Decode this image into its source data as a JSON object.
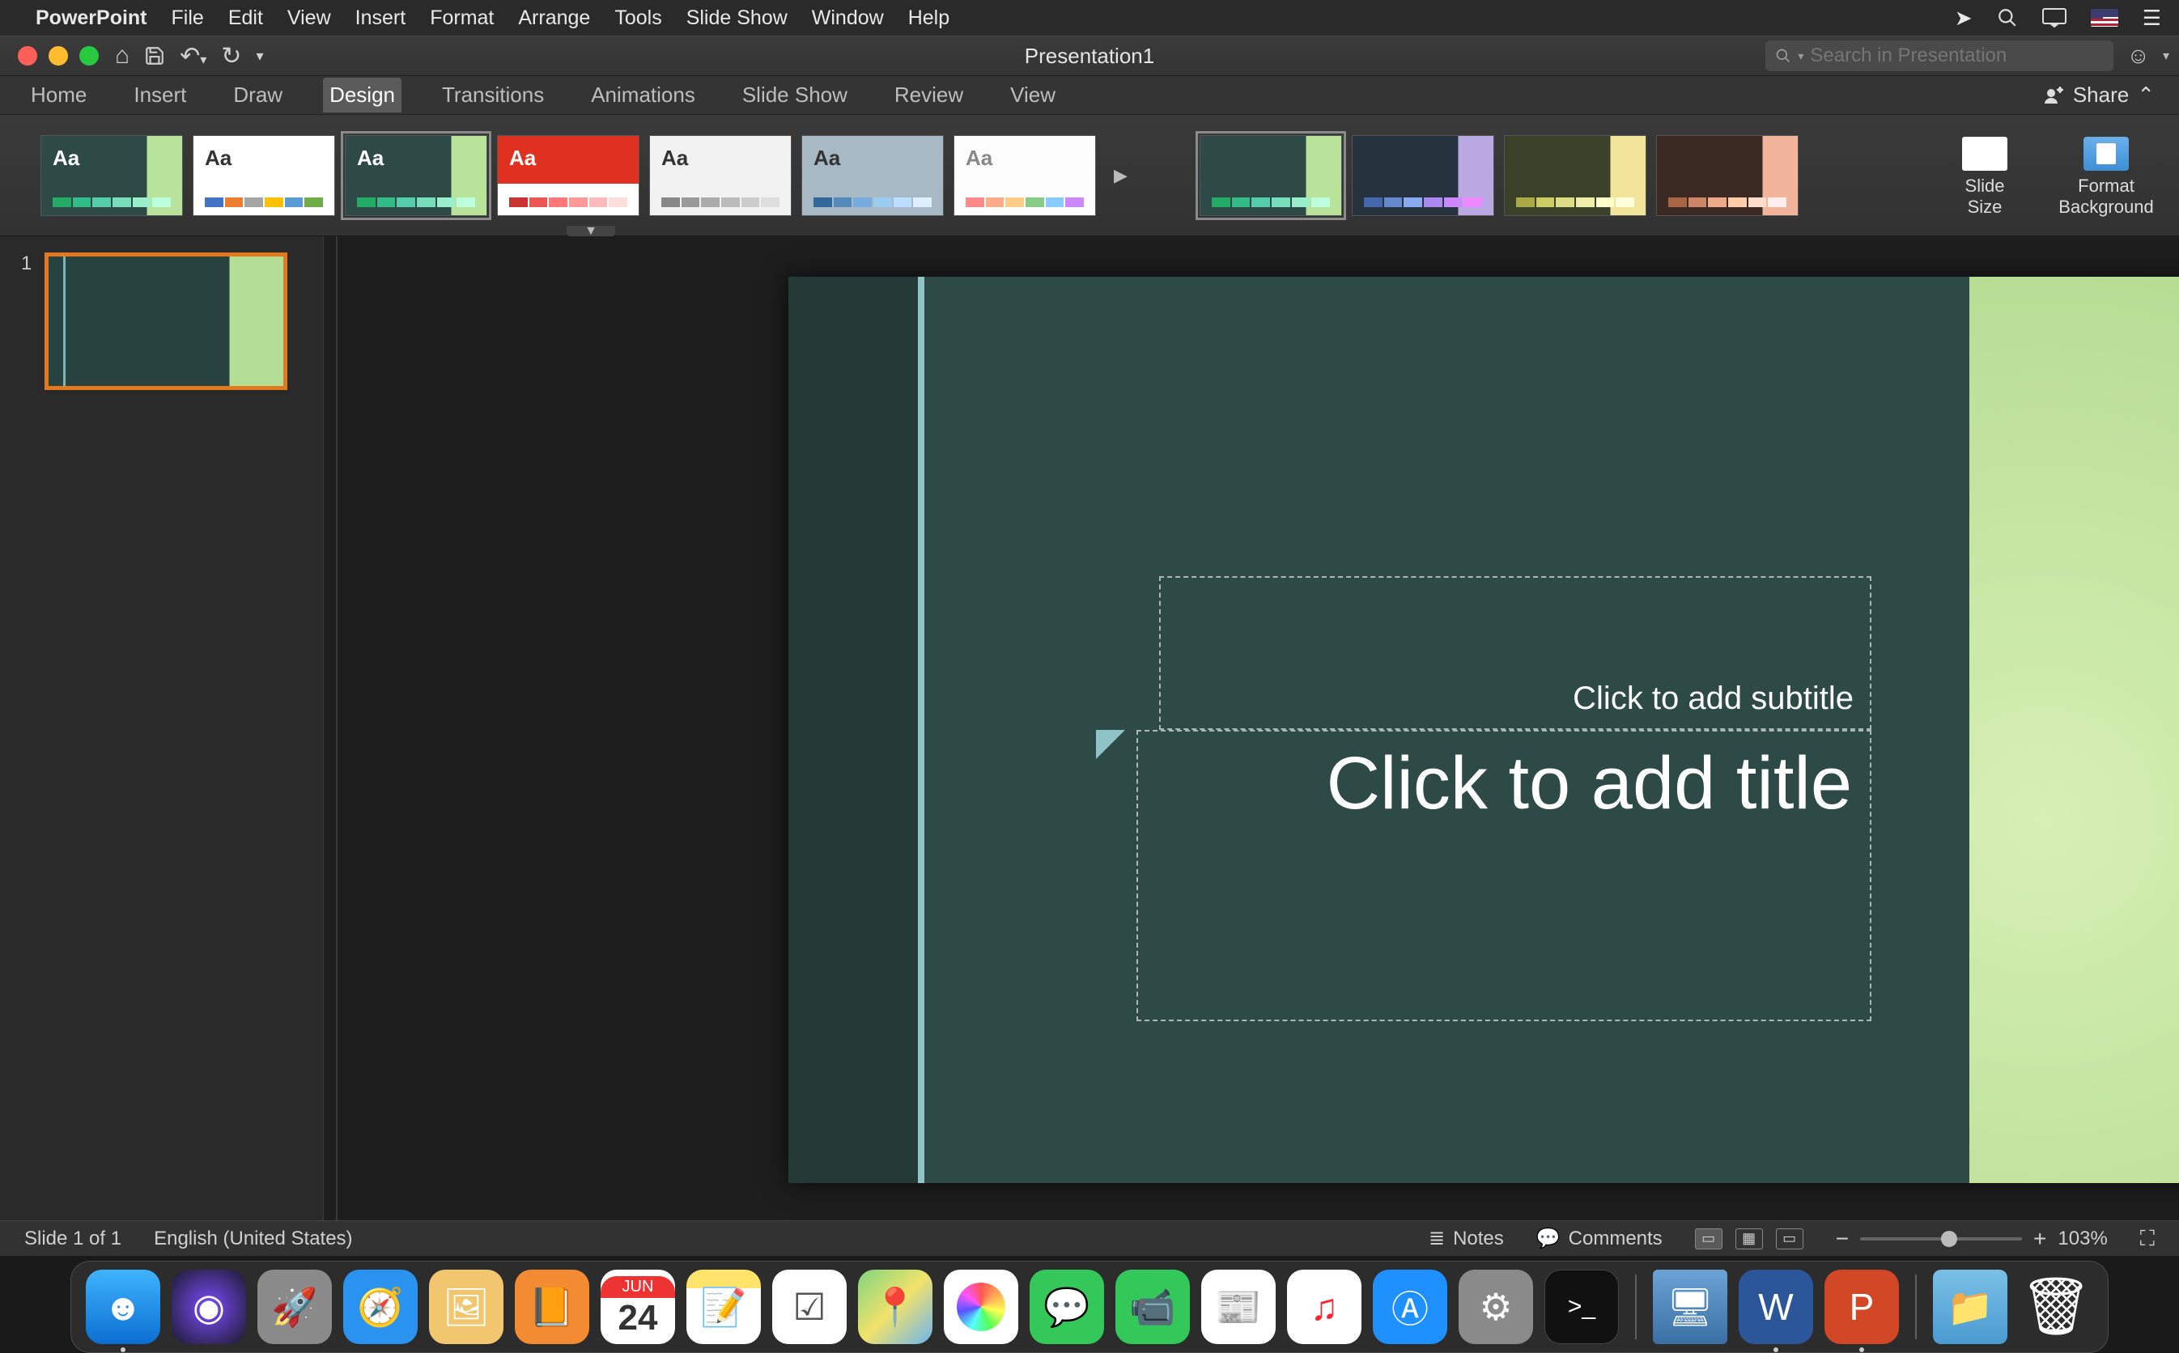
{
  "menubar": {
    "app": "PowerPoint",
    "items": [
      "File",
      "Edit",
      "View",
      "Insert",
      "Format",
      "Arrange",
      "Tools",
      "Slide Show",
      "Window",
      "Help"
    ]
  },
  "titlebar": {
    "doc_title": "Presentation1",
    "search_placeholder": "Search in Presentation"
  },
  "ribbon_tabs": [
    "Home",
    "Insert",
    "Draw",
    "Design",
    "Transitions",
    "Animations",
    "Slide Show",
    "Review",
    "View"
  ],
  "ribbon_active_tab": "Design",
  "share_label": "Share",
  "design": {
    "themes_aa": "Aa",
    "slide_size_label": "Slide\nSize",
    "format_bg_label": "Format\nBackground"
  },
  "slide_panel": {
    "slides": [
      {
        "number": "1"
      }
    ]
  },
  "slide": {
    "subtitle_placeholder": "Click to add subtitle",
    "title_placeholder": "Click to add title"
  },
  "statusbar": {
    "slide_info": "Slide 1 of 1",
    "language": "English (United States)",
    "notes": "Notes",
    "comments": "Comments",
    "zoom": "103%"
  },
  "dock": {
    "calendar_month": "JUN",
    "calendar_day": "24",
    "terminal_prompt": ">_"
  }
}
